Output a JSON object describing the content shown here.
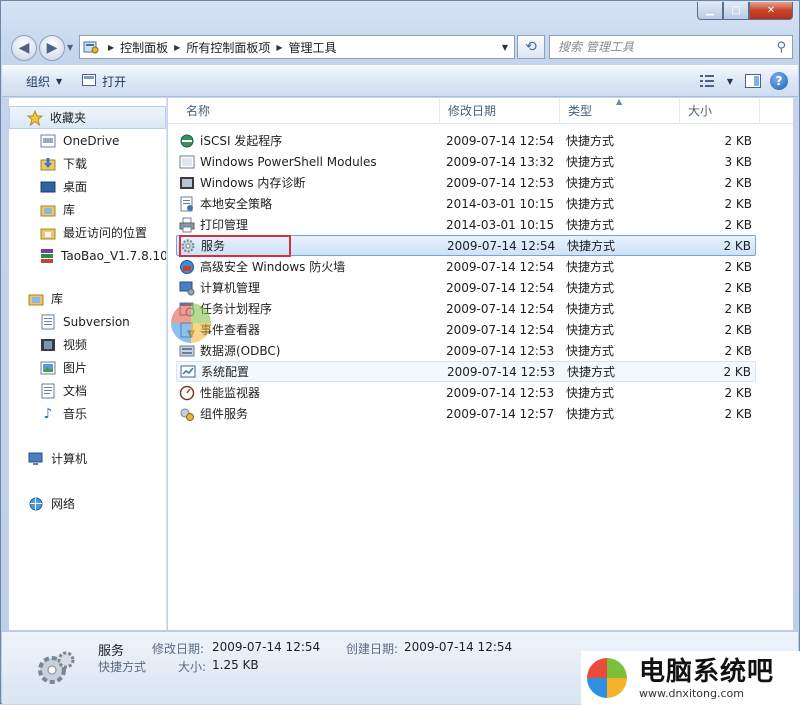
{
  "breadcrumb": [
    "控制面板",
    "所有控制面板项",
    "管理工具"
  ],
  "search": {
    "placeholder": "搜索 管理工具"
  },
  "toolbar": {
    "organize": "组织",
    "open": "打开"
  },
  "sidebar": {
    "favorites": "收藏夹",
    "items": [
      "OneDrive",
      "下载",
      "桌面",
      "库",
      "最近访问的位置",
      "TaoBao_V1.7.8.10_"
    ],
    "libraries": "库",
    "library_items": [
      "Subversion",
      "视频",
      "图片",
      "文档",
      "音乐"
    ],
    "computer": "计算机",
    "network": "网络"
  },
  "columns": {
    "name": "名称",
    "date": "修改日期",
    "type": "类型",
    "size": "大小"
  },
  "files": [
    {
      "name": "iSCSI 发起程序",
      "date": "2009-07-14 12:54",
      "type": "快捷方式",
      "size": "2 KB",
      "icon": "iscsi-icon"
    },
    {
      "name": "Windows PowerShell Modules",
      "date": "2009-07-14 13:32",
      "type": "快捷方式",
      "size": "3 KB",
      "icon": "powershell-icon"
    },
    {
      "name": "Windows 内存诊断",
      "date": "2009-07-14 12:53",
      "type": "快捷方式",
      "size": "2 KB",
      "icon": "memory-icon"
    },
    {
      "name": "本地安全策略",
      "date": "2014-03-01 10:15",
      "type": "快捷方式",
      "size": "2 KB",
      "icon": "security-policy-icon"
    },
    {
      "name": "打印管理",
      "date": "2014-03-01 10:15",
      "type": "快捷方式",
      "size": "2 KB",
      "icon": "printer-icon"
    },
    {
      "name": "服务",
      "date": "2009-07-14 12:54",
      "type": "快捷方式",
      "size": "2 KB",
      "icon": "services-gear-icon"
    },
    {
      "name": "高级安全 Windows 防火墙",
      "date": "2009-07-14 12:54",
      "type": "快捷方式",
      "size": "2 KB",
      "icon": "firewall-icon"
    },
    {
      "name": "计算机管理",
      "date": "2009-07-14 12:54",
      "type": "快捷方式",
      "size": "2 KB",
      "icon": "computer-management-icon"
    },
    {
      "name": "任务计划程序",
      "date": "2009-07-14 12:54",
      "type": "快捷方式",
      "size": "2 KB",
      "icon": "task-scheduler-icon"
    },
    {
      "name": "事件查看器",
      "date": "2009-07-14 12:54",
      "type": "快捷方式",
      "size": "2 KB",
      "icon": "event-viewer-icon"
    },
    {
      "name": "数据源(ODBC)",
      "date": "2009-07-14 12:53",
      "type": "快捷方式",
      "size": "2 KB",
      "icon": "odbc-icon"
    },
    {
      "name": "系统配置",
      "date": "2009-07-14 12:53",
      "type": "快捷方式",
      "size": "2 KB",
      "icon": "system-config-icon"
    },
    {
      "name": "性能监视器",
      "date": "2009-07-14 12:53",
      "type": "快捷方式",
      "size": "2 KB",
      "icon": "performance-monitor-icon"
    },
    {
      "name": "组件服务",
      "date": "2009-07-14 12:57",
      "type": "快捷方式",
      "size": "2 KB",
      "icon": "component-services-icon"
    }
  ],
  "status": {
    "name": "服务",
    "type": "快捷方式",
    "modified_label": "修改日期:",
    "modified_value": "2009-07-14 12:54",
    "created_label": "创建日期:",
    "created_value": "2009-07-14 12:54",
    "size_label": "大小:",
    "size_value": "1.25 KB"
  },
  "watermark": {
    "title": "电脑系统吧",
    "url": "www.dnxitong.com",
    "center_url": "www.dnxitong.com"
  },
  "colors": {
    "selection": "#cde2f8",
    "highlight_box": "#d9303e",
    "accent": "#1f5fb6"
  }
}
